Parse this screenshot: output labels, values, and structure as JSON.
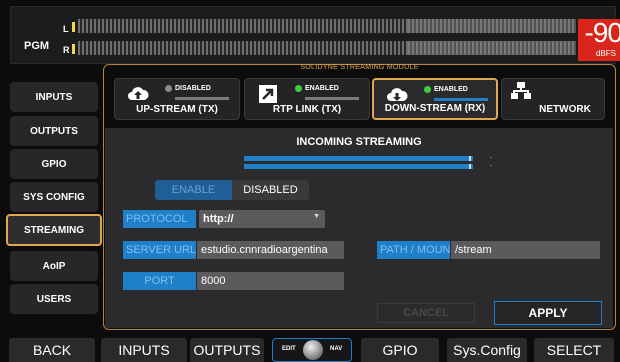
{
  "meter": {
    "label": "PGM",
    "left_channel": "L",
    "right_channel": "R",
    "level": "-90",
    "unit": "dBFS"
  },
  "nav": {
    "items": [
      {
        "label": "INPUTS"
      },
      {
        "label": "OUTPUTS"
      },
      {
        "label": "GPIO"
      },
      {
        "label": "SYS CONFIG"
      },
      {
        "label": "STREAMING"
      },
      {
        "label": "AoIP"
      },
      {
        "label": "USERS"
      }
    ],
    "active": "STREAMING"
  },
  "module": {
    "title": "SOLIDYNE STREAMING MODULE",
    "tabs": [
      {
        "label": "UP-STREAM (TX)",
        "state": "DISABLED",
        "state_color": "#8a8a8a",
        "icon": "cloud-upload-icon"
      },
      {
        "label": "RTP LINK (TX)",
        "state": "ENABLED",
        "state_color": "#3ccf3c",
        "icon": "arrow-up-right-icon"
      },
      {
        "label": "DOWN-STREAM (RX)",
        "state": "ENABLED",
        "state_color": "#3ccf3c",
        "icon": "cloud-download-icon"
      },
      {
        "label": "NETWORK",
        "icon": "network-icon"
      }
    ],
    "active_tab": "DOWN-STREAM (RX)"
  },
  "content": {
    "heading": "INCOMING STREAMING",
    "level_marks": [
      "-",
      "-"
    ],
    "toggle": {
      "enable_label": "ENABLE",
      "disabled_label": "DISABLED",
      "selected": "ENABLE"
    },
    "protocol": {
      "label": "PROTOCOL",
      "value": "http://"
    },
    "server": {
      "label": "SERVER URL",
      "value": "estudio.cnnradioargentina"
    },
    "path": {
      "label": "PATH / MOUNT",
      "value": "/stream"
    },
    "port": {
      "label": "PORT",
      "value": "8000"
    },
    "cancel_label": "CANCEL",
    "apply_label": "APPLY"
  },
  "bottom": {
    "back": "BACK",
    "inputs": "INPUTS",
    "outputs": "OUTPUTS",
    "knob_left": "EDIT",
    "knob_right": "NAV",
    "gpio": "GPIO",
    "sysconfig": "Sys.Config",
    "select": "SELECT"
  },
  "colors": {
    "accent": "#e0a94e",
    "blue": "#1f7fc9",
    "level_bg": "#d9261c"
  }
}
